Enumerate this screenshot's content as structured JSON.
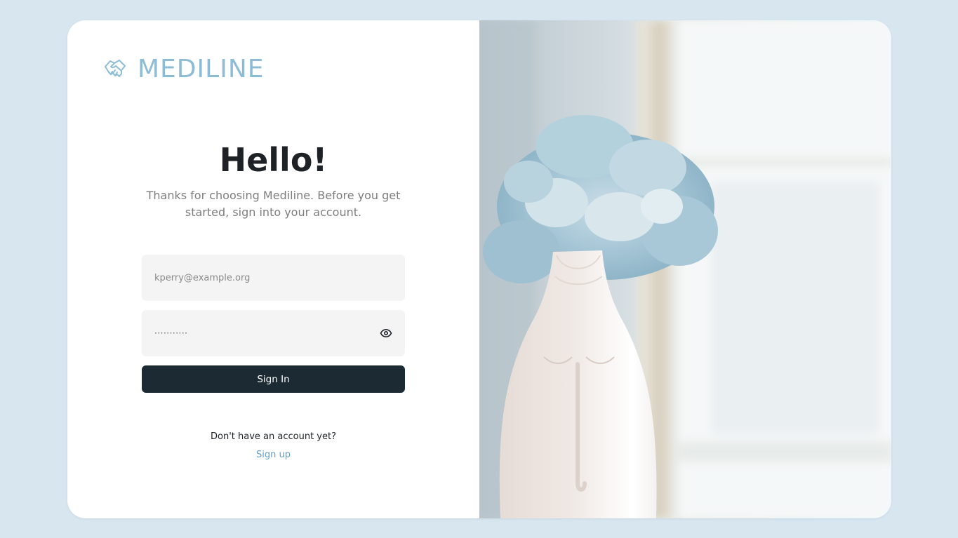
{
  "brand": {
    "name": "MEDILINE",
    "icon": "handshake-icon",
    "color": "#8dbdd6"
  },
  "heading": "Hello!",
  "subtitle": "Thanks for choosing Mediline. Before you get started, sign into your account.",
  "form": {
    "email_placeholder": "kperry@example.org",
    "password_mask": "···········",
    "password_toggle_icon": "eye-icon",
    "signin_label": "Sign In"
  },
  "footer": {
    "no_account_text": "Don't have an account yet?",
    "signup_label": "Sign up"
  },
  "colors": {
    "background": "#d8e6f0",
    "button": "#1c2a33",
    "link": "#5f9fc3",
    "field": "#f4f4f4"
  },
  "image": {
    "icon": "vase-with-hydrangeas-photo"
  }
}
